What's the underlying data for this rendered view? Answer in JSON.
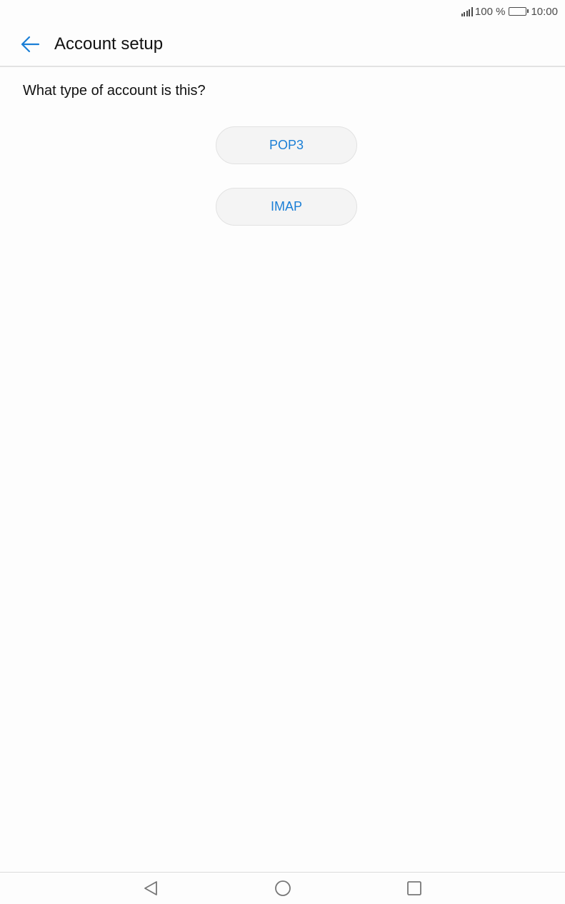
{
  "status_bar": {
    "battery_percent": "100 %",
    "time": "10:00",
    "icons": [
      "signal-icon",
      "battery-icon"
    ]
  },
  "header": {
    "title": "Account setup",
    "back_icon": "arrow-left-icon"
  },
  "main": {
    "question": "What type of account is this?",
    "options": [
      {
        "label": "POP3"
      },
      {
        "label": "IMAP"
      }
    ]
  },
  "nav_bar": {
    "icons": [
      "nav-back-icon",
      "nav-home-icon",
      "nav-recent-icon"
    ]
  },
  "colors": {
    "accent": "#1b7fd6",
    "background": "#fdfdfd",
    "button_bg": "#f4f4f4"
  }
}
